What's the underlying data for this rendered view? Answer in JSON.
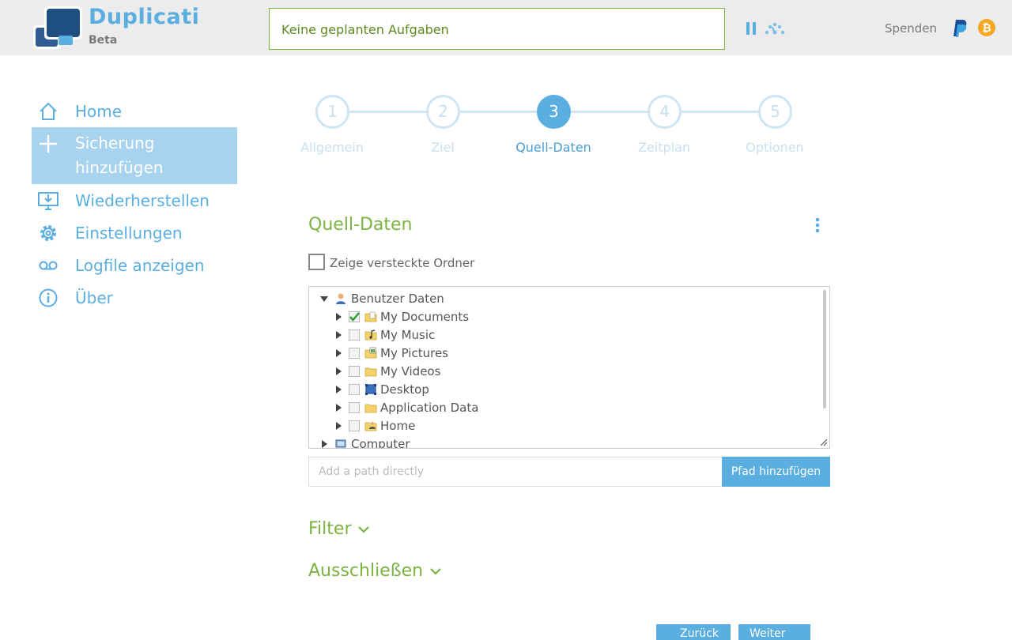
{
  "header": {
    "brand": "Duplicati",
    "edition": "Beta",
    "status": "Keine geplanten Aufgaben",
    "donate_label": "Spenden",
    "colors": {
      "brand": "#5aaee0",
      "status_border": "#7cb342"
    }
  },
  "sidebar": {
    "items": [
      {
        "label": "Home",
        "icon": "home-icon"
      },
      {
        "label": "Sicherung hinzufügen",
        "icon": "plus-icon",
        "active": true
      },
      {
        "label": "Wiederherstellen",
        "icon": "restore-icon"
      },
      {
        "label": "Einstellungen",
        "icon": "gear-icon"
      },
      {
        "label": "Logfile anzeigen",
        "icon": "voicemail-icon"
      },
      {
        "label": "Über",
        "icon": "info-icon"
      }
    ]
  },
  "wizard": {
    "current_step": 3,
    "steps": [
      {
        "number": "1",
        "label": "Allgemein"
      },
      {
        "number": "2",
        "label": "Ziel"
      },
      {
        "number": "3",
        "label": "Quell-Daten"
      },
      {
        "number": "4",
        "label": "Zeitplan"
      },
      {
        "number": "5",
        "label": "Optionen"
      }
    ]
  },
  "source": {
    "title": "Quell-Daten",
    "show_hidden_label": "Zeige versteckte Ordner",
    "tree": {
      "root": "Benutzer Daten",
      "children": [
        {
          "label": "My Documents",
          "checked": true,
          "icon": "documents-folder-icon"
        },
        {
          "label": "My Music",
          "checked": false,
          "icon": "music-folder-icon"
        },
        {
          "label": "My Pictures",
          "checked": false,
          "icon": "pictures-folder-icon"
        },
        {
          "label": "My Videos",
          "checked": false,
          "icon": "folder-icon"
        },
        {
          "label": "Desktop",
          "checked": false,
          "icon": "desktop-icon"
        },
        {
          "label": "Application Data",
          "checked": false,
          "icon": "folder-icon"
        },
        {
          "label": "Home",
          "checked": false,
          "icon": "home-folder-icon"
        }
      ],
      "second_root": "Computer"
    },
    "path_placeholder": "Add a path directly",
    "add_path_button": "Pfad hinzufügen"
  },
  "filter": {
    "label": "Filter"
  },
  "exclude": {
    "label": "Ausschließen"
  },
  "footer": {
    "back_label": "Zurück",
    "next_label": "Weiter"
  }
}
